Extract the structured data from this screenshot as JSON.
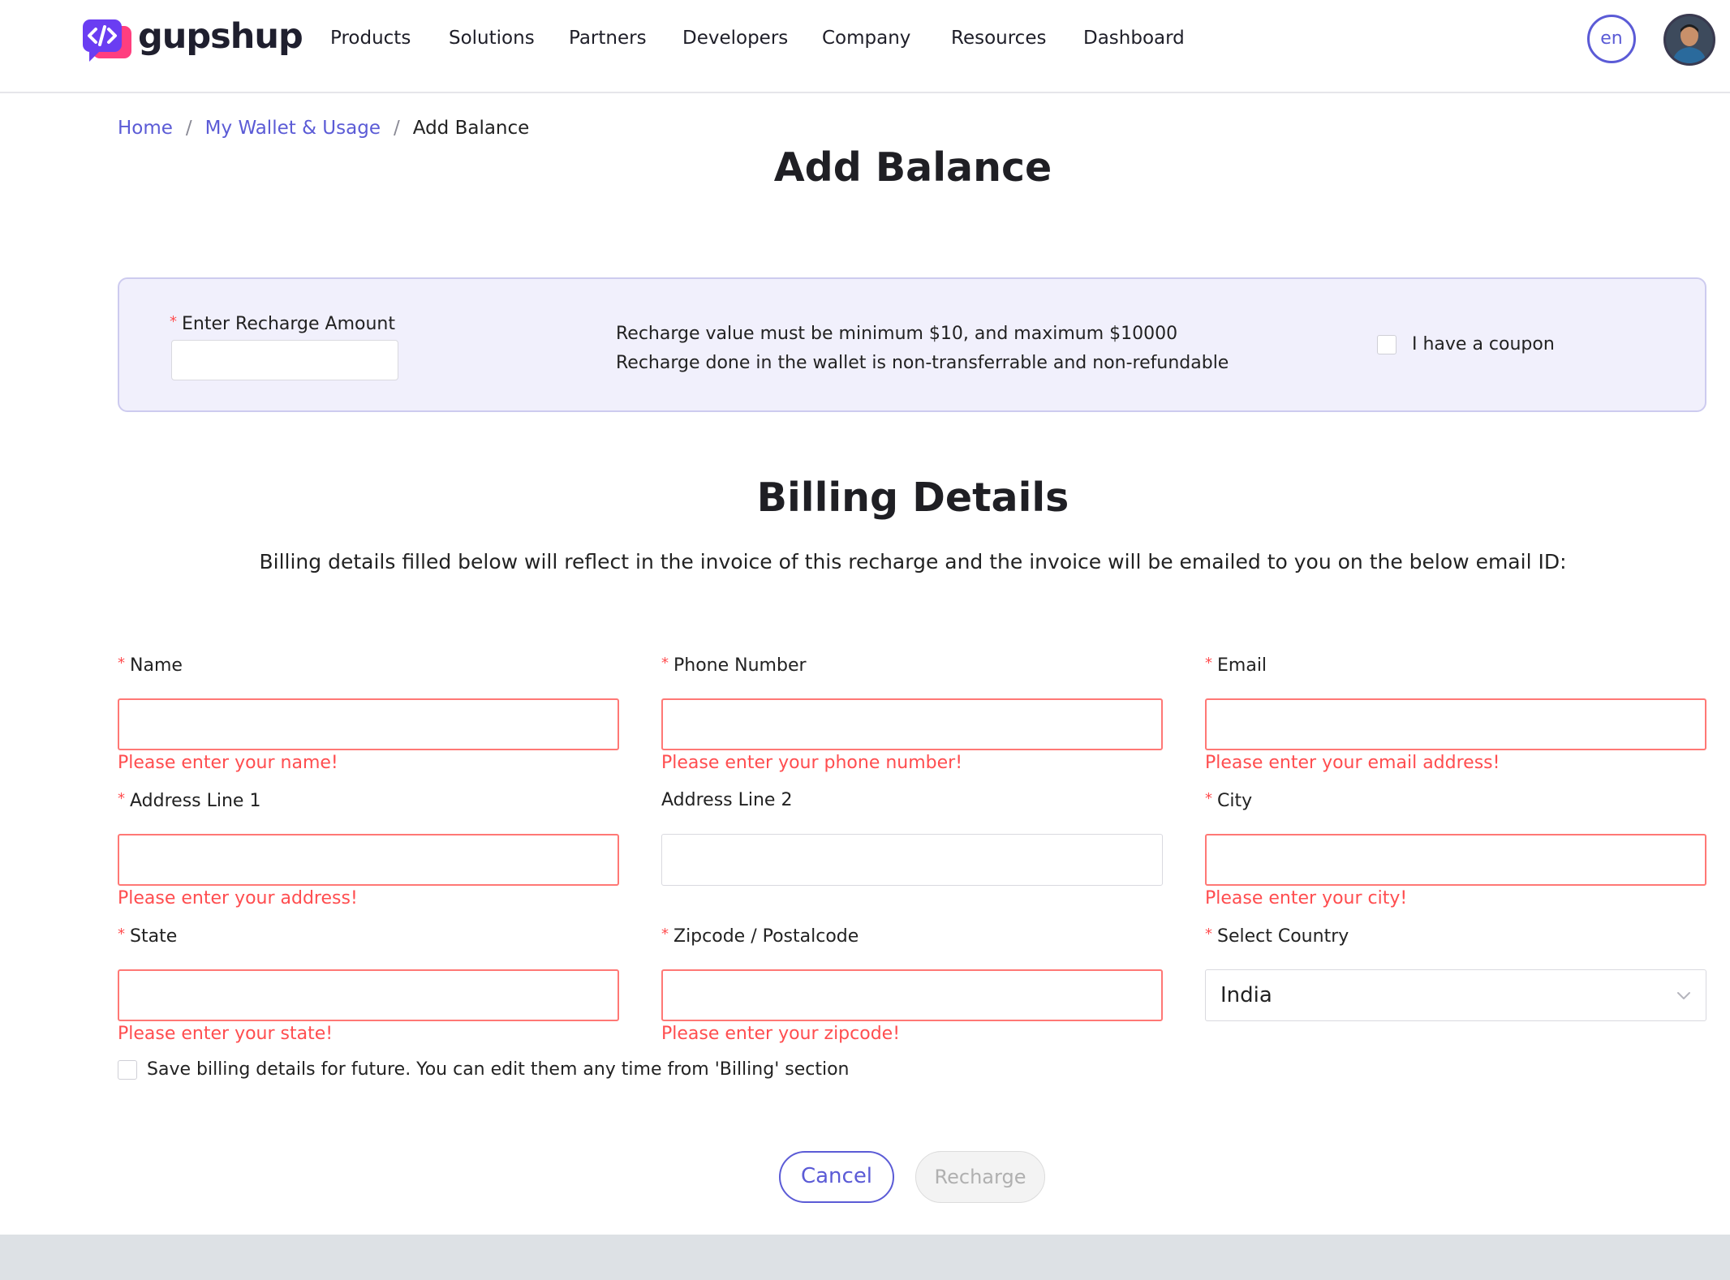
{
  "header": {
    "brand": "gupshup",
    "nav": [
      "Products",
      "Solutions",
      "Partners",
      "Developers",
      "Company",
      "Resources",
      "Dashboard"
    ],
    "language": "en",
    "accent_color": "#5b5bd6"
  },
  "breadcrumb": {
    "home": "Home",
    "wallet": "My Wallet & Usage",
    "current": "Add Balance",
    "separator": "/"
  },
  "page_title": "Add Balance",
  "recharge": {
    "required_mark": "*",
    "amount_label": "Enter Recharge Amount",
    "amount_value": "",
    "note_line1": "Recharge value must be minimum $10, and maximum $10000",
    "note_line2": "Recharge done in the wallet is non-transferrable and non-refundable",
    "coupon_label": "I have a coupon"
  },
  "billing": {
    "title": "Billing Details",
    "description": "Billing details filled below will reflect in the invoice of this recharge and the invoice will be emailed to you on the below email ID:",
    "fields": {
      "name": {
        "label": "Name",
        "value": "",
        "error": "Please enter your name!"
      },
      "phone": {
        "label": "Phone Number",
        "value": "",
        "error": "Please enter your phone number!"
      },
      "email": {
        "label": "Email",
        "value": "",
        "error": "Please enter your email address!"
      },
      "address1": {
        "label": "Address Line 1",
        "value": "",
        "error": "Please enter your address!"
      },
      "address2": {
        "label": "Address Line 2",
        "value": ""
      },
      "city": {
        "label": "City",
        "value": "",
        "error": "Please enter your city!"
      },
      "state": {
        "label": "State",
        "value": "",
        "error": "Please enter your state!"
      },
      "zipcode": {
        "label": "Zipcode / Postalcode",
        "value": "",
        "error": "Please enter your zipcode!"
      },
      "country": {
        "label": "Select Country",
        "value": "India"
      }
    },
    "save_label": "Save billing details for future. You can edit them any time from 'Billing' section"
  },
  "buttons": {
    "cancel": "Cancel",
    "recharge": "Recharge"
  },
  "icons": {
    "logo": "gupshup-code-chat-icon",
    "avatar": "user-avatar",
    "select_arrow": "chevron-down-icon"
  }
}
